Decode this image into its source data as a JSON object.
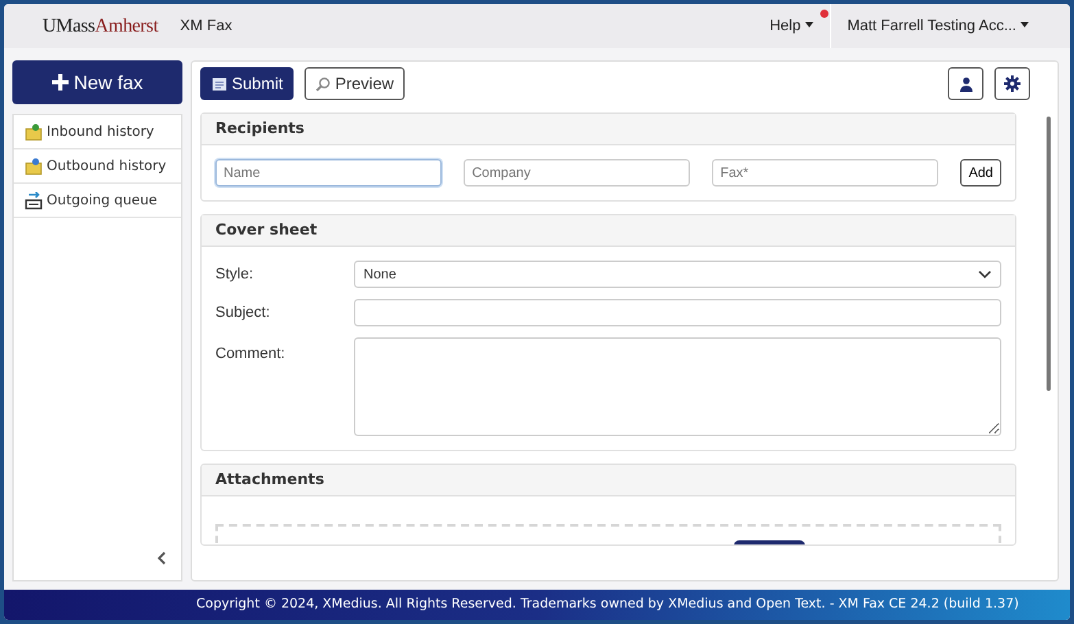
{
  "header": {
    "logo_part1": "UMass",
    "logo_part2": "Amherst",
    "app_name": "XM Fax",
    "help": "Help",
    "help_notification": true,
    "account": "Matt Farrell Testing Acc..."
  },
  "sidebar": {
    "new_button": "New fax",
    "items": [
      {
        "label": "Inbound history",
        "kind": "inbound",
        "selected": false
      },
      {
        "label": "Outbound history",
        "kind": "outbound",
        "selected": false
      },
      {
        "label": "Outgoing queue",
        "kind": "queue",
        "selected": false
      }
    ]
  },
  "toolbar": {
    "submit": "Submit",
    "preview": "Preview"
  },
  "recipients": {
    "title": "Recipients",
    "fields": [
      {
        "placeholder": "Name",
        "focused": true
      },
      {
        "placeholder": "Company",
        "focused": false
      },
      {
        "placeholder": "Fax*",
        "focused": false
      }
    ],
    "add": "Add"
  },
  "cover_sheet": {
    "title": "Cover sheet",
    "style_label": "Style:",
    "style_value": "None",
    "subject_label": "Subject:",
    "comment_label": "Comment:"
  },
  "attachments": {
    "title": "Attachments"
  },
  "footer": "Copyright © 2024, XMedius. All Rights Reserved. Trademarks owned by XMedius and Open Text. - XM Fax CE 24.2 (build 1.37)"
}
